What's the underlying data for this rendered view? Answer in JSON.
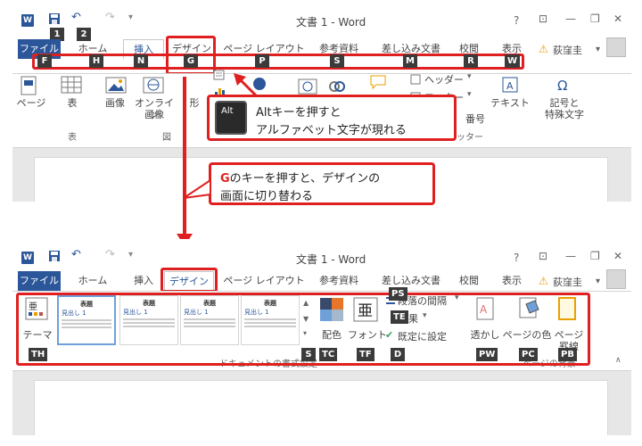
{
  "window": {
    "title": "文書 1 - Word",
    "user": "荻窪圭",
    "help": "?"
  },
  "tabs_top": [
    {
      "label": "ファイル"
    },
    {
      "label": "ホーム"
    },
    {
      "label": "挿入"
    },
    {
      "label": "デザイン"
    },
    {
      "label": "ページ レイアウト"
    },
    {
      "label": "参考資料"
    },
    {
      "label": "差し込み文書"
    },
    {
      "label": "校閲"
    },
    {
      "label": "表示"
    }
  ],
  "tabs_bottom": [
    {
      "label": "ファイル"
    },
    {
      "label": "ホーム"
    },
    {
      "label": "挿入"
    },
    {
      "label": "デザイン"
    },
    {
      "label": "ページ レイアウト"
    },
    {
      "label": "参考資料"
    },
    {
      "label": "差し込み文書"
    },
    {
      "label": "校閲"
    },
    {
      "label": "表示"
    }
  ],
  "keytips_qat": [
    "1",
    "2"
  ],
  "keytips_tabs": [
    "F",
    "H",
    "N",
    "G",
    "P",
    "S",
    "M",
    "R",
    "W"
  ],
  "top_ribbon": {
    "page": "ページ",
    "table": "表",
    "picture": "画像",
    "online_picture_1": "オンライン",
    "online_picture_2": "画像",
    "shapes": "形",
    "header": "ヘッダー",
    "footer": "フッター",
    "page_number": "番号",
    "textbox": "テキスト",
    "symbol_1": "記号と",
    "symbol_2": "特殊文字",
    "group_table": "表",
    "group_illust": "図",
    "group_hf": "フッター"
  },
  "callout1": {
    "key": "Alt",
    "line1": "Altキーを押すと",
    "line2": "アルファベット文字が現れる"
  },
  "callout2": {
    "key_letter": "G",
    "line1_rest": "のキーを押すと、デザインの",
    "line2": "画面に切り替わる"
  },
  "bottom_ribbon": {
    "theme": "テーマ",
    "theme_boxes": [
      {
        "title": "表題",
        "heading": "見出し 1"
      },
      {
        "title": "表題",
        "heading": "見出し 1"
      },
      {
        "title": "表題",
        "heading": "見出し 1"
      },
      {
        "title": "表題",
        "heading": "見出し 1"
      }
    ],
    "colors": "配色",
    "fonts": "フォント",
    "paragraph_spacing": "段落の間隔",
    "effects": "果",
    "set_default": "既定に設定",
    "watermark": "透かし",
    "page_color": "ページの色",
    "page_border_1": "ページ",
    "page_border_2": "罫線",
    "group_format": "ドキュメントの書式設定",
    "group_bg": "ページの背景"
  },
  "keytips_design": [
    "TH",
    "S",
    "TC",
    "TF",
    "PS",
    "TE",
    "D",
    "PW",
    "PC",
    "PB"
  ],
  "colors": {
    "accent": "#2b579a",
    "highlight": "#e02020",
    "keytip": "#3b3b3b"
  }
}
